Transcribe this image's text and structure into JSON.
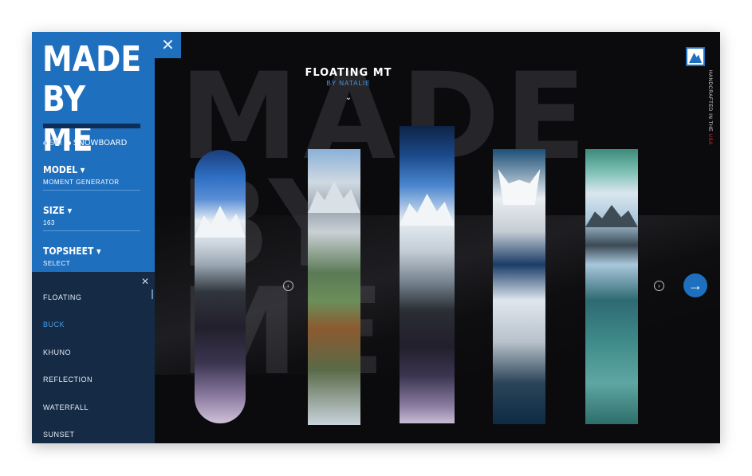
{
  "brand": {
    "line1": "MADE",
    "line2": "BY ME"
  },
  "sport_toggle": {
    "ski": "SKI",
    "snowboard": "SNOWBOARD",
    "selected": "SNOWBOARD"
  },
  "fields": {
    "model": {
      "label": "MODEL",
      "value": "MOMENT GENERATOR"
    },
    "size": {
      "label": "SIZE",
      "value": "163"
    },
    "topsheet": {
      "label": "TOPSHEET",
      "value": "SELECT"
    }
  },
  "topsheet_list": {
    "items": [
      "FLOATING",
      "BUCK",
      "KHUNO",
      "REFLECTION",
      "WATERFALL",
      "SUNSET"
    ],
    "active": "BUCK"
  },
  "header": {
    "title": "FLOATING MT",
    "subtitle": "BY NATALIE"
  },
  "badge": {
    "line1": "HANDCRAFTED",
    "line2": "IN THE",
    "highlight": "USA"
  },
  "background_text": [
    "MADE",
    "BY",
    "ME"
  ],
  "icons": {
    "close": "close-icon",
    "prev": "chevron-left-icon",
    "next": "chevron-right-icon",
    "next_big": "arrow-right-icon",
    "expand": "chevron-down-icon"
  },
  "colors": {
    "accent": "#1f6fbf",
    "panel_dark": "#152b45",
    "active_item": "#4a9be8",
    "badge_red": "#e0332f"
  }
}
